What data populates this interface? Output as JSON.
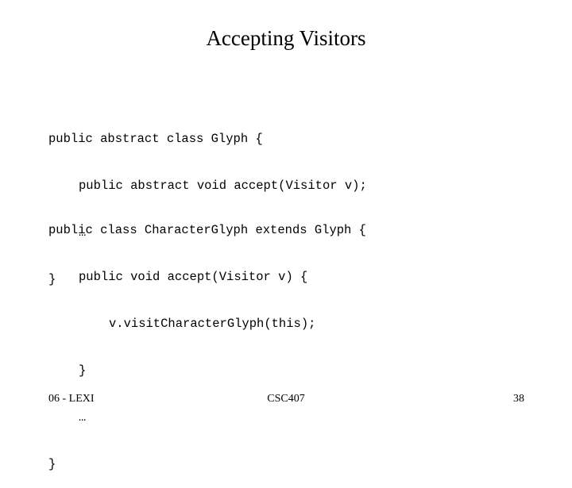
{
  "slide": {
    "title": "Accepting Visitors",
    "code_blocks": [
      {
        "lines": [
          {
            "indent": 0,
            "text": "public abstract class Glyph {"
          },
          {
            "indent": 1,
            "text": "public abstract void accept(Visitor v);"
          },
          {
            "indent": 1,
            "text": "…"
          },
          {
            "indent": 0,
            "text": "}"
          }
        ]
      },
      {
        "lines": [
          {
            "indent": 0,
            "text": "public class CharacterGlyph extends Glyph {"
          },
          {
            "indent": 1,
            "text": "public void accept(Visitor v) {"
          },
          {
            "indent": 2,
            "text": "v.visitCharacterGlyph(this);"
          },
          {
            "indent": 1,
            "text": "}"
          },
          {
            "indent": 1,
            "text": "…"
          },
          {
            "indent": 0,
            "text": "}"
          }
        ]
      }
    ]
  },
  "footer": {
    "left": "06 - LEXI",
    "center": "CSC407",
    "page_number": "38"
  }
}
